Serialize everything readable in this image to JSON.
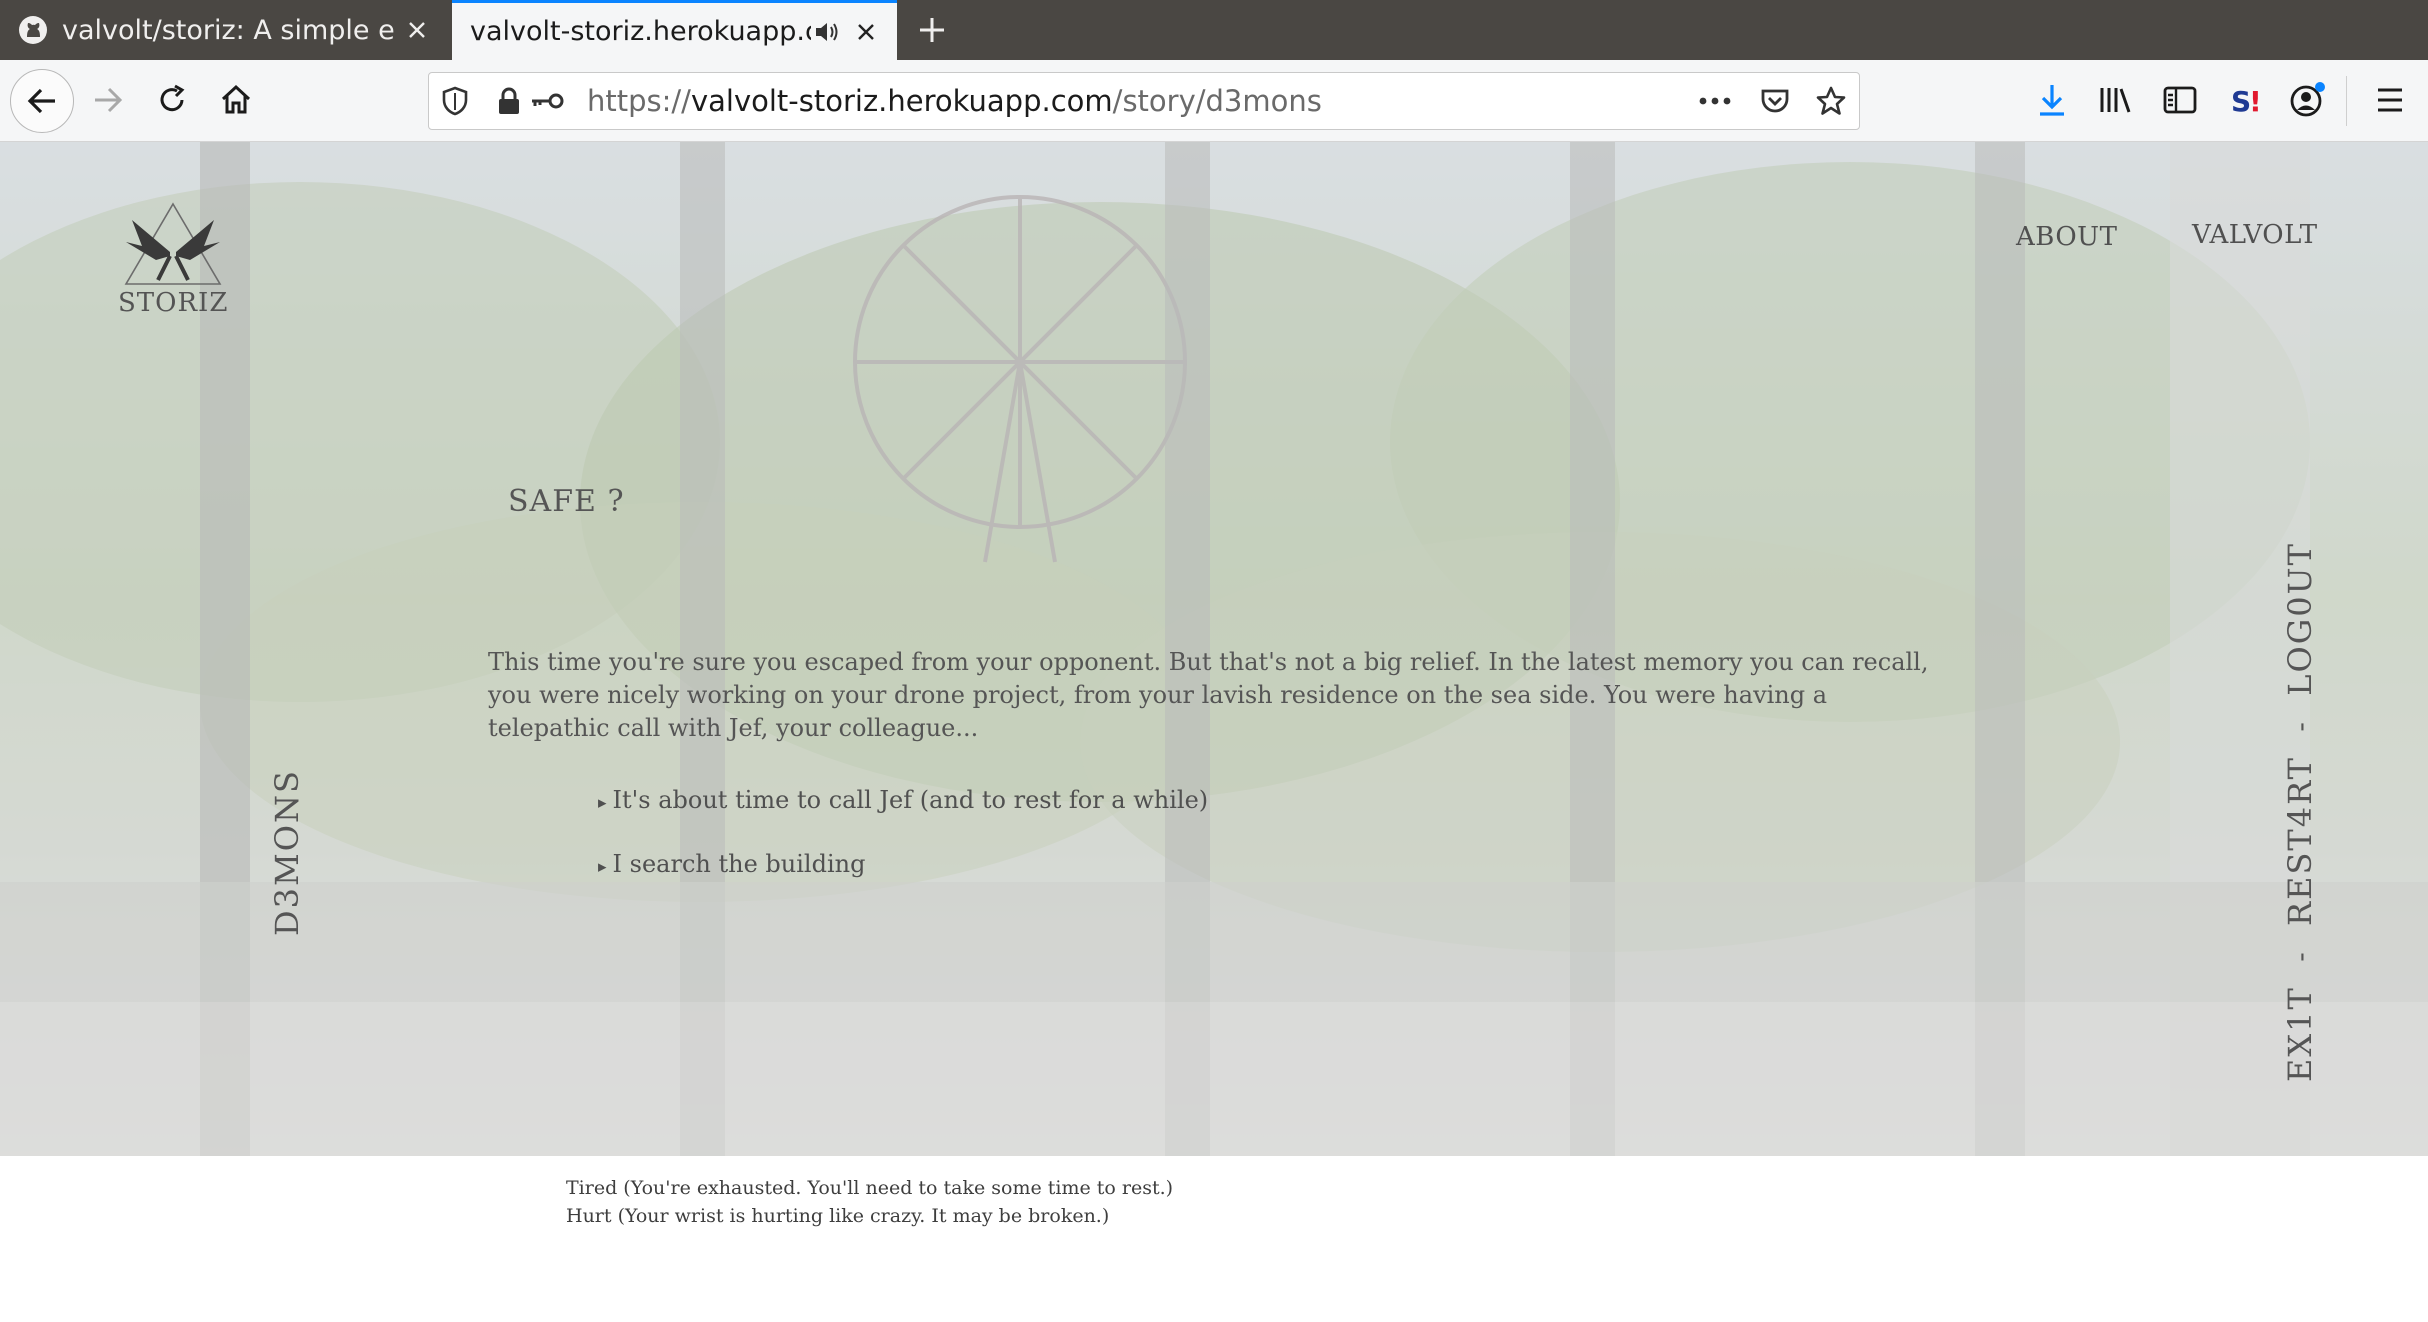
{
  "browser": {
    "tabs": [
      {
        "title": "valvolt/storiz: A simple e",
        "active": false,
        "favicon": "github-icon"
      },
      {
        "title": "valvolt-storiz.herokuapp.c",
        "active": true,
        "audio": true
      }
    ],
    "url": {
      "scheme": "https://",
      "host": "valvolt-storiz.herokuapp.com",
      "path": "/story/d3mons"
    }
  },
  "site": {
    "logo_text": "STORIZ",
    "nav": {
      "about": "ABOUT",
      "valvolt": "VALVOLT"
    },
    "story_name": "D3MONS",
    "side_menu": {
      "logout": "LOG0UT",
      "restart": "REST4RT",
      "exit": "EX1T",
      "separator": "-"
    }
  },
  "story": {
    "title": "SAFE ?",
    "text": "This time you're sure you escaped from your opponent. But that's not a big relief. In the latest memory you can recall, you were nicely working on your drone project, from your lavish residence on the sea side. You were having a telepathic call with Jef, your colleague...",
    "choices": [
      "It's about time to call Jef (and to rest for a while)",
      "I search the building"
    ],
    "choice_marker": "▸"
  },
  "statuses": [
    "Tired (You're exhausted. You'll need to take some time to rest.)",
    "Hurt (Your wrist is hurting like crazy. It may be broken.)"
  ],
  "colors": {
    "tab_strip": "#4a4743",
    "active_tab_accent": "#0a84ff",
    "page_text": "#555555"
  }
}
